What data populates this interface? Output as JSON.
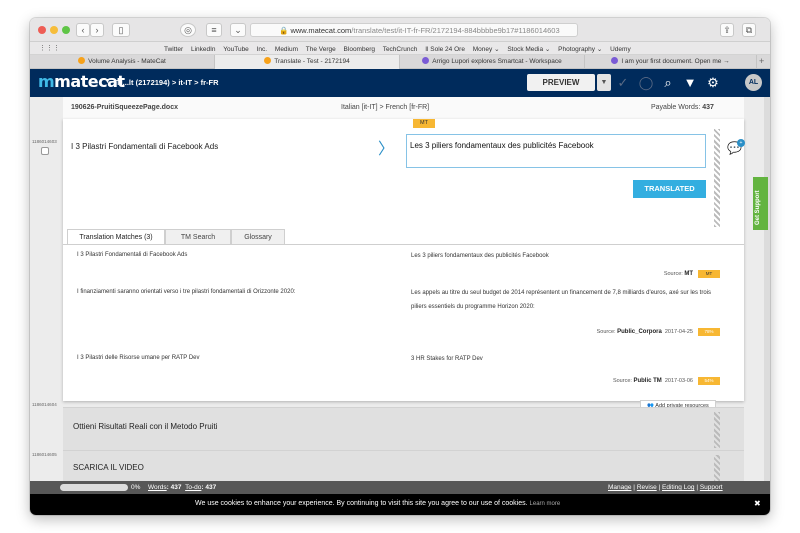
{
  "browser": {
    "url_prefix": "www.matecat.com",
    "url_path": "/translate/test/it-IT-fr-FR/2172194-884bbbbe9b17#1186014603",
    "bookmarks": [
      "Twitter",
      "LinkedIn",
      "YouTube",
      "Inc.",
      "Medium",
      "The Verge",
      "Bloomberg",
      "TechCrunch",
      "Il Sole 24 Ore",
      "Money ⌄",
      "Stock Media ⌄",
      "Photography ⌄",
      "Udemy"
    ],
    "tabs": [
      {
        "label": "Volume Analysis - MateCat",
        "color": "#f7a21b"
      },
      {
        "label": "Translate - Test - 2172194",
        "color": "#f7a21b"
      },
      {
        "label": "Arrigo Lupori explores Smartcat - Workspace",
        "color": "#7a5bd6"
      },
      {
        "label": "I am your first document. Open me →",
        "color": "#7a5bd6"
      }
    ]
  },
  "app": {
    "logo": "matecat",
    "breadcrumb": "Tl...lt (2172194) > it-IT > fr-FR",
    "preview_label": "PREVIEW",
    "avatar": "AL"
  },
  "editor": {
    "file_name": "190626-PruitiSqueezePage.docx",
    "language_pair": "Italian [it-IT] > French [fr-FR]",
    "payable_words_label": "Payable Words:",
    "payable_words": "437",
    "segment_id": "1186014603",
    "mt_badge": "MT",
    "source_text": "I 3 Pilastri Fondamentali di Facebook Ads",
    "target_text": "Les 3 piliers fondamentaux des publicités Facebook",
    "status_button": "TRANSLATED"
  },
  "panel": {
    "tabs": [
      "Translation Matches (3)",
      "TM Search",
      "Glossary"
    ],
    "matches": [
      {
        "source": "I 3 Pilastri Fondamentali di Facebook Ads",
        "target": "Les 3 piliers fondamentaux des publicités Facebook",
        "source_label": "Source:",
        "provider": "MT",
        "date": "",
        "score": "MT"
      },
      {
        "source": "I finanziamenti saranno orientati verso i tre pilastri fondamentali di Orizzonte 2020:",
        "target": "Les appels au titre du seul budget de 2014 représentent un financement de 7,8 milliards d'euros, axé sur les trois piliers essentiels du programme Horizon 2020:",
        "source_label": "Source:",
        "provider": "Public_Corpora",
        "date": "2017-04-25",
        "score": "78%"
      },
      {
        "source": "I 3 Pilastri delle Risorse umane per RATP Dev",
        "target": "3 HR Stakes for RATP Dev",
        "source_label": "Source:",
        "provider": "Public TM",
        "date": "2017-03-06",
        "score": "54%"
      }
    ],
    "add_private": "Add private resources"
  },
  "segments": [
    {
      "id": "1186014604",
      "text": "Ottieni Risultati Reali con il Metodo Pruiti"
    },
    {
      "id": "1186014605",
      "text": "SCARICA IL VIDEO"
    }
  ],
  "support_label": "Get Support",
  "footer": {
    "progress": "0%",
    "words": "Words",
    "words_value": ": 437",
    "todo": "To-do",
    "todo_value": ": 437",
    "links": [
      "Manage",
      "Revise",
      "Editing Log",
      "Support"
    ]
  },
  "cookie": {
    "text": "We use cookies to enhance your experience. By continuing to visit this site you agree to our use of cookies.",
    "learn_more": "Learn more",
    "close": "✖"
  }
}
